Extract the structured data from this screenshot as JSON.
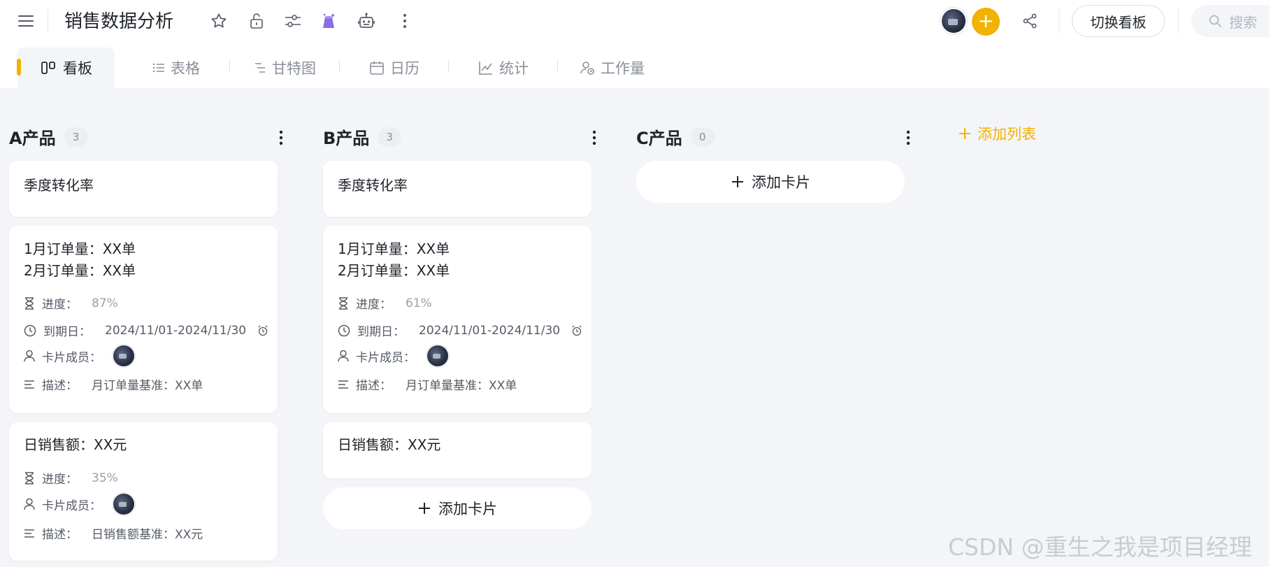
{
  "header": {
    "title": "销售数据分析",
    "switch_board_label": "切换看板",
    "search_placeholder": "搜索",
    "accent_color": "#f2b200"
  },
  "tabs": [
    {
      "label": "看板",
      "icon": "board-icon",
      "active": true
    },
    {
      "label": "表格",
      "icon": "list-icon"
    },
    {
      "label": "甘特图",
      "icon": "gantt-icon"
    },
    {
      "label": "日历",
      "icon": "calendar-icon"
    },
    {
      "label": "统计",
      "icon": "chart-icon"
    },
    {
      "label": "工作量",
      "icon": "workload-icon"
    }
  ],
  "columns": [
    {
      "title": "A产品",
      "count": "3",
      "cards": [
        {
          "title": "季度转化率"
        },
        {
          "title_line1": "1月订单量：XX单",
          "title_line2": "2月订单量：XX单",
          "progress_label": "进度：",
          "progress": "87%",
          "due_label": "到期日：",
          "due": "2024/11/01-2024/11/30",
          "members_label": "卡片成员：",
          "desc_label": "描述：",
          "desc": "月订单量基准：XX单"
        },
        {
          "title": "日销售额：XX元",
          "progress_label": "进度：",
          "progress": "35%",
          "members_label": "卡片成员：",
          "desc_label": "描述：",
          "desc": "日销售额基准：XX元"
        }
      ]
    },
    {
      "title": "B产品",
      "count": "3",
      "cards": [
        {
          "title": "季度转化率"
        },
        {
          "title_line1": "1月订单量：XX单",
          "title_line2": "2月订单量：XX单",
          "progress_label": "进度：",
          "progress": "61%",
          "due_label": "到期日：",
          "due": "2024/11/01-2024/11/30",
          "members_label": "卡片成员：",
          "desc_label": "描述：",
          "desc": "月订单量基准：XX单"
        },
        {
          "title": "日销售额：XX元"
        }
      ],
      "add_card_label": "添加卡片"
    },
    {
      "title": "C产品",
      "count": "0",
      "cards": [],
      "add_card_label": "添加卡片"
    }
  ],
  "add_list_label": "添加列表",
  "watermark": "CSDN @重生之我是项目经理"
}
